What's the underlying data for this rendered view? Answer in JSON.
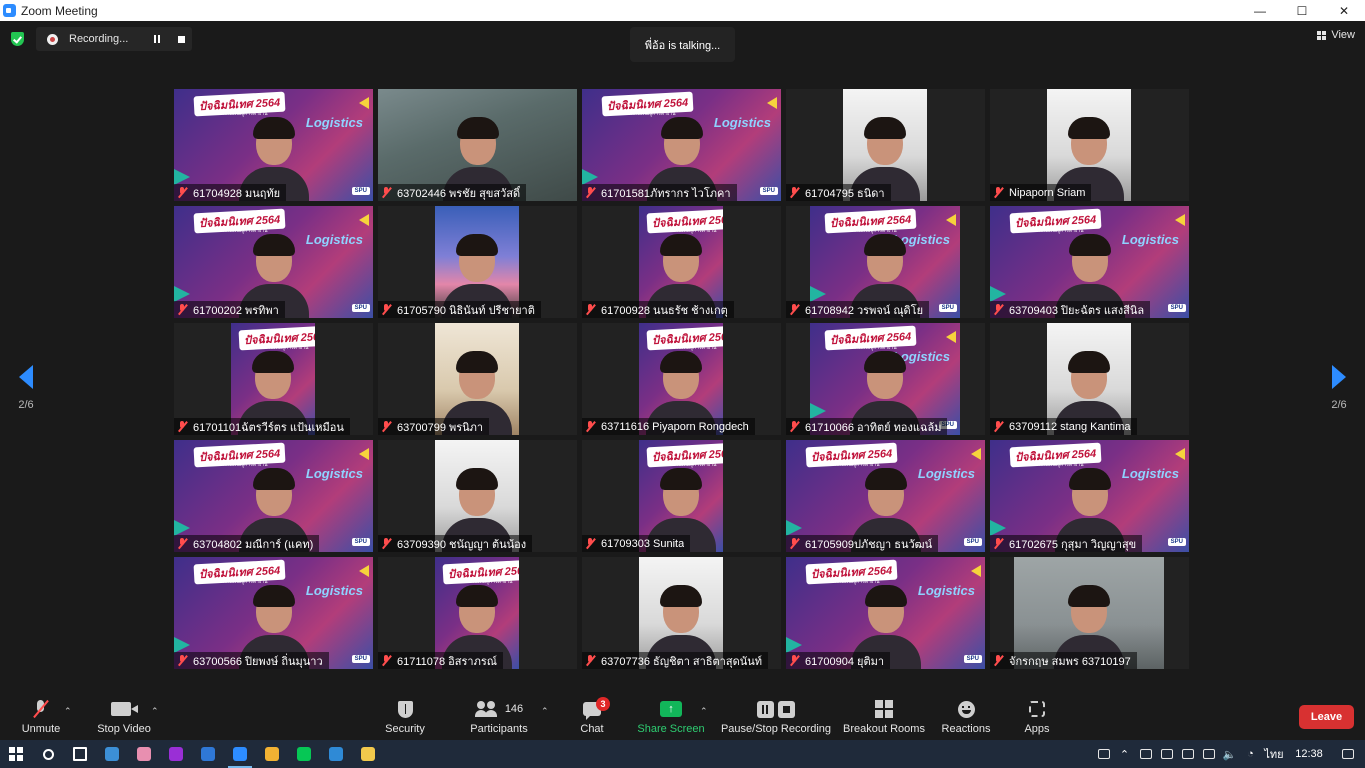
{
  "window": {
    "title": "Zoom Meeting",
    "controls": [
      "—",
      "☐",
      "✕"
    ]
  },
  "recording": {
    "label": "Recording..."
  },
  "talking": {
    "text": "พี่อ้อ  is  talking..."
  },
  "view": {
    "label": "View"
  },
  "pagination": {
    "left": "2/6",
    "right": "2/6"
  },
  "banner": {
    "title": "ปัจฉิมนิเทศ 2564",
    "subtitle": "แสงเเชิดความเพิ่มสู่การทำงาน",
    "logistics": "Logistics",
    "spu": "SPU"
  },
  "participants": [
    {
      "name": "61704928 มนฤทัย",
      "bg": "banner",
      "layout": "full"
    },
    {
      "name": "63702446 พรชัย สุขสวัสดิ์",
      "bg": "room",
      "layout": "full"
    },
    {
      "name": "61701581ภัทรากร ไวโภคา",
      "bg": "banner",
      "layout": "full"
    },
    {
      "name": "61704795 ธนิดา",
      "bg": "white",
      "layout": "w84"
    },
    {
      "name": "Nipaporn Sriam",
      "bg": "white",
      "layout": "w84"
    },
    {
      "name": "61700202 พรทิพา",
      "bg": "banner",
      "layout": "full"
    },
    {
      "name": "61705790 นิธินันท์ ปรีชายาติ",
      "bg": "sky",
      "layout": "w84"
    },
    {
      "name": "61700928  นนธรัช ช้างเกตุ",
      "bg": "banner",
      "layout": "w84"
    },
    {
      "name": "61708942 วรพจน์ ณุดิโย",
      "bg": "banner",
      "layout": "w150"
    },
    {
      "name": "63709403 ปิยะฉัตร แสงสีนิล",
      "bg": "banner",
      "layout": "full"
    },
    {
      "name": "61701101ฉัตรวีร์ตร แป้นเหมือน",
      "bg": "banner",
      "layout": "w84"
    },
    {
      "name": "63700799 พรนิภา",
      "bg": "beige",
      "layout": "w84"
    },
    {
      "name": "63711616 Piyaporn Rongdech",
      "bg": "banner",
      "layout": "w84"
    },
    {
      "name": "61710066 อาทิตย์ ทองแฉล้ม",
      "bg": "banner",
      "layout": "w150"
    },
    {
      "name": "63709112 stang Kantima",
      "bg": "white",
      "layout": "w84"
    },
    {
      "name": "63704802  มณีการ์ (แคท)",
      "bg": "banner",
      "layout": "full"
    },
    {
      "name": "63709390 ชนัญญา ต้นน้อง",
      "bg": "white",
      "layout": "w84"
    },
    {
      "name": "61709303 Sunita",
      "bg": "banner",
      "layout": "w84"
    },
    {
      "name": "61705909ปภัชญา ธนวัฒน์",
      "bg": "banner",
      "layout": "full"
    },
    {
      "name": "61702675 กุสุมา วิญญาสุข",
      "bg": "banner",
      "layout": "full"
    },
    {
      "name": "63700566 ปิยพงษ์ ถิ่นมุนาว",
      "bg": "banner",
      "layout": "full"
    },
    {
      "name": "61711078 อิสราภรณ์",
      "bg": "banner",
      "layout": "w84"
    },
    {
      "name": "63707736 ธัญชิตา สาธิตาสุดนันท์",
      "bg": "white",
      "layout": "w84"
    },
    {
      "name": "61700904 ยุติมา",
      "bg": "banner",
      "layout": "full"
    },
    {
      "name": "จักรกฤษ สมพร 63710197",
      "bg": "grey",
      "layout": "w150"
    }
  ],
  "toolbar": {
    "unmute": "Unmute",
    "stop_video": "Stop Video",
    "security": "Security",
    "participants": "Participants",
    "participants_count": "146",
    "chat": "Chat",
    "chat_badge": "3",
    "share_screen": "Share Screen",
    "pause_stop_recording": "Pause/Stop Recording",
    "breakout_rooms": "Breakout Rooms",
    "reactions": "Reactions",
    "apps": "Apps",
    "leave": "Leave"
  },
  "taskbar": {
    "time": "12:38",
    "language": "ไทย",
    "apps": [
      {
        "icon": "search-icon",
        "color": "#ffffff"
      },
      {
        "icon": "task-view-icon",
        "color": "#ffffff"
      },
      {
        "icon": "file-explorer-icon",
        "color": "#3c8fd6"
      },
      {
        "icon": "paint-icon",
        "color": "#e88fb0"
      },
      {
        "icon": "premiere-icon",
        "color": "#9a2fd6"
      },
      {
        "icon": "photoshop-icon",
        "color": "#2f78d6"
      },
      {
        "icon": "zoom-icon",
        "color": "#2d8cff"
      },
      {
        "icon": "chrome-icon",
        "color": "#f2b233"
      },
      {
        "icon": "line-icon",
        "color": "#06c755"
      },
      {
        "icon": "media-icon",
        "color": "#2f8ad6"
      },
      {
        "icon": "folder-icon",
        "color": "#f2c94c"
      }
    ]
  },
  "colors": {
    "accent": "#2d8cff",
    "leave": "#d83131",
    "share": "#12b65a",
    "muted": "#ff4d4d"
  }
}
